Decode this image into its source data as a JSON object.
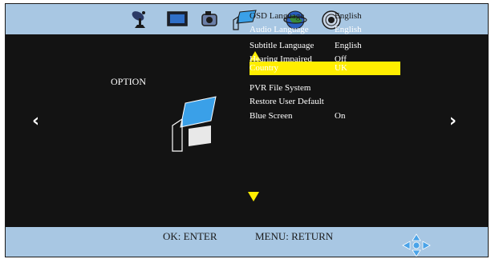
{
  "header": {
    "icons": [
      "satellite-icon",
      "tv-screen-icon",
      "camera-icon",
      "option-icon",
      "globe-icon",
      "gear-icon"
    ]
  },
  "section": {
    "title": "OPTION"
  },
  "menu": {
    "items": [
      {
        "label": "OSD Language",
        "value": "English"
      },
      {
        "label": "Audio Language",
        "value": "English"
      },
      {
        "label": "Subtitle Language",
        "value": "English"
      },
      {
        "label": "Hearing Impaired",
        "value": "Off"
      },
      {
        "label": "Country",
        "value": "UK"
      },
      {
        "label": "PVR File System",
        "value": ""
      },
      {
        "label": "Restore User Default",
        "value": ""
      },
      {
        "label": "Blue Screen",
        "value": "On"
      }
    ],
    "selected_index": 4
  },
  "footer": {
    "enter_hint": "OK: ENTER",
    "return_hint": "MENU: RETURN"
  },
  "colors": {
    "highlight": "#ffee00",
    "bar": "#a8c7e3",
    "panel": "#131313"
  }
}
